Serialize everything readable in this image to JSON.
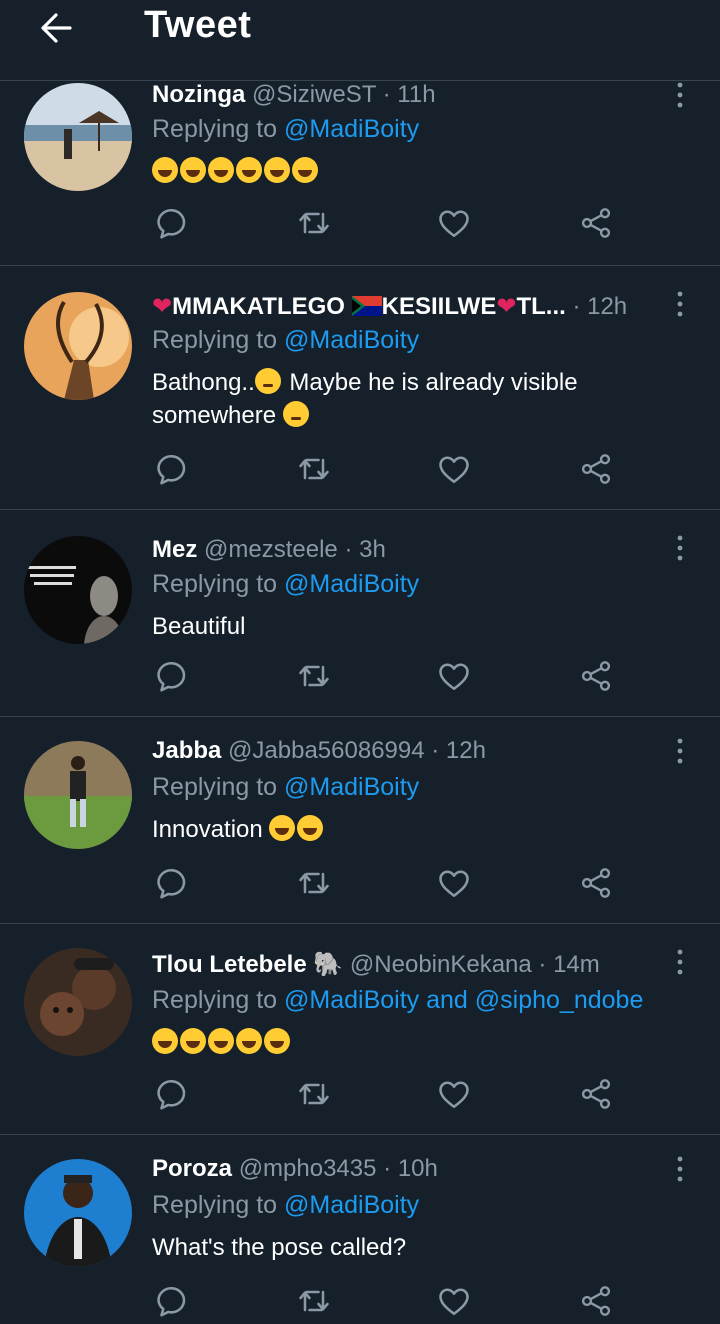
{
  "header": {
    "title": "Tweet"
  },
  "replying_prefix": "Replying to",
  "tweets": [
    {
      "name": "Nozinga",
      "handle": "@SiziweST",
      "time": "· 11h",
      "mentions": "@MadiBoity",
      "text": "",
      "emoji": "🤣🤣🤣🤣🤣🤣"
    },
    {
      "name": "MMAKATLEGO",
      "name2": "KESIILWE",
      "name3": "TL...",
      "handle": "",
      "time": "· 12h",
      "mentions": "@MadiBoity",
      "text": "Bathong..",
      "text2": "Maybe he is already visible somewhere"
    },
    {
      "name": "Mez",
      "handle": "@mezsteele",
      "time": "· 3h",
      "mentions": "@MadiBoity",
      "text": "Beautiful"
    },
    {
      "name": "Jabba",
      "handle": "@Jabba56086994",
      "time": "· 12h",
      "mentions": "@MadiBoity",
      "text": "Innovation"
    },
    {
      "name": "Tlou Letebele",
      "handle": "@NeobinKekana",
      "time": "· 14m",
      "mentions": "@MadiBoity and @sipho_ndobe",
      "text": ""
    },
    {
      "name": "Poroza",
      "handle": "@mpho3435",
      "time": "· 10h",
      "mentions": "@MadiBoity",
      "text": "What's the pose called?"
    }
  ],
  "colors": {
    "background": "#15202b",
    "accent": "#1d9bf0",
    "muted": "#8b98a5",
    "divider": "#38444d"
  }
}
